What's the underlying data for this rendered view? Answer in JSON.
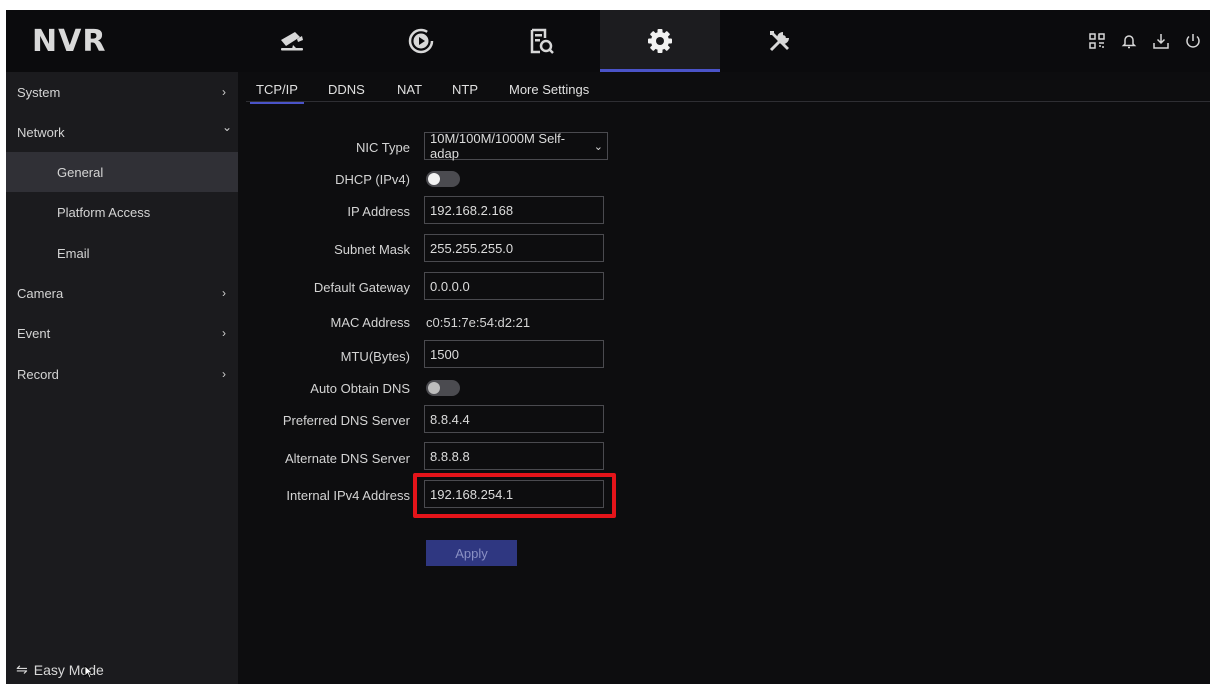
{
  "app": {
    "logo": "NVR"
  },
  "nav_tabs": [
    {
      "icon": "camera-icon"
    },
    {
      "icon": "playback-icon"
    },
    {
      "icon": "file-search-icon"
    },
    {
      "icon": "gear-icon",
      "active": true
    },
    {
      "icon": "tools-icon"
    }
  ],
  "top_right_icons": [
    "qr-code-icon",
    "bell-icon",
    "download-icon",
    "power-icon"
  ],
  "sidebar": {
    "items": [
      {
        "label": "System",
        "chevron": "›"
      },
      {
        "label": "Network",
        "chevron": "⌄"
      },
      {
        "label": "General"
      },
      {
        "label": "Platform Access"
      },
      {
        "label": "Email"
      },
      {
        "label": "Camera",
        "chevron": "›"
      },
      {
        "label": "Event",
        "chevron": "›"
      },
      {
        "label": "Record",
        "chevron": "›"
      }
    ],
    "easy_mode": "Easy Mode",
    "easy_mode_icon": "⇋"
  },
  "subtabs": [
    "TCP/IP",
    "DDNS",
    "NAT",
    "NTP",
    "More Settings"
  ],
  "form": {
    "nic_type_label": "NIC Type",
    "nic_type_value": "10M/100M/1000M Self-adap",
    "dhcp_label": "DHCP (IPv4)",
    "dhcp_enabled": false,
    "ip_label": "IP Address",
    "ip_value": "192.168.2.168",
    "subnet_label": "Subnet Mask",
    "subnet_value": "255.255.255.0",
    "gateway_label": "Default Gateway",
    "gateway_value": "0.0.0.0",
    "mac_label": "MAC Address",
    "mac_value": "c0:51:7e:54:d2:21",
    "mtu_label": "MTU(Bytes)",
    "mtu_value": "1500",
    "auto_dns_label": "Auto Obtain DNS",
    "auto_dns_enabled": false,
    "pref_dns_label": "Preferred DNS Server",
    "pref_dns_value": "8.8.4.4",
    "alt_dns_label": "Alternate DNS Server",
    "alt_dns_value": "8.8.8.8",
    "internal_ipv4_label": "Internal IPv4 Address",
    "internal_ipv4_value": "192.168.254.1",
    "apply_label": "Apply"
  },
  "colors": {
    "accent": "#4a53c8",
    "highlight_box": "#e4141a",
    "apply_button": "#2f3781"
  }
}
